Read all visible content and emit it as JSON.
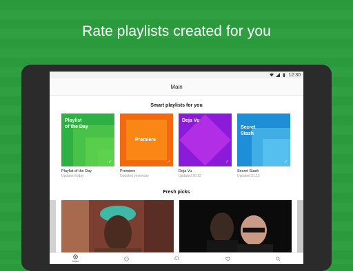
{
  "headline": "Rate playlists created for you",
  "status": {
    "time": "12:30"
  },
  "appbar": {
    "title": "Main"
  },
  "smart": {
    "title": "Smart playlists for you",
    "cards": [
      {
        "tile_label": "Playlist\nof the Day",
        "name": "Playlist of the Day",
        "sub": "Updated today",
        "color": "#2fb044",
        "accent": "#5ed24e"
      },
      {
        "tile_label": "Premiere",
        "name": "Premiere",
        "sub": "Updated yesterday",
        "color": "#f26a10",
        "accent": "#ff9c1a"
      },
      {
        "tile_label": "Deja Vu",
        "name": "Deja Vu",
        "sub": "Updated 20.12",
        "color": "#8b1ad9",
        "accent": "#d23ff0"
      },
      {
        "tile_label": "Secret\nStash",
        "name": "Secret Stash",
        "sub": "Updated 21.12",
        "color": "#1e8fd6",
        "accent": "#5cc7f2"
      }
    ]
  },
  "fresh": {
    "title": "Fresh picks"
  },
  "nav": {
    "main_label": "Main"
  },
  "icons": [
    "wifi-icon",
    "signal-icon",
    "battery-icon",
    "main-icon",
    "chat-icon",
    "radio-icon",
    "heart-icon",
    "search-icon",
    "check-icon"
  ]
}
